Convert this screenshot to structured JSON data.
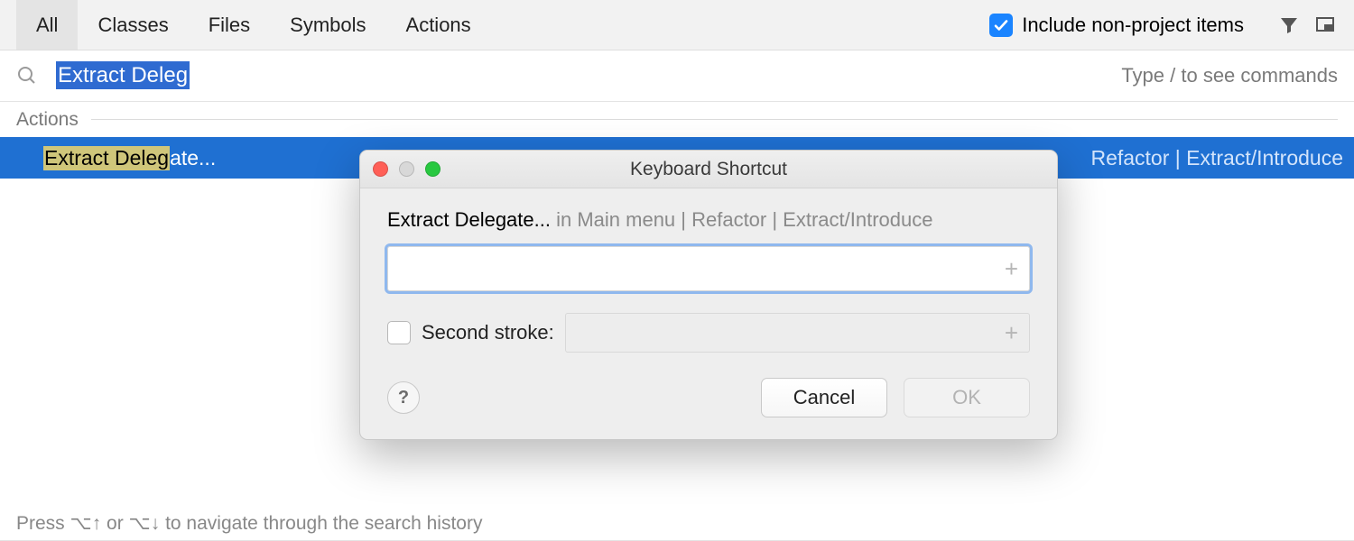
{
  "tabs": {
    "all": "All",
    "classes": "Classes",
    "files": "Files",
    "symbols": "Symbols",
    "actions": "Actions"
  },
  "include_label": "Include non-project items",
  "include_checked": true,
  "search": {
    "query": "Extract Deleg",
    "hint": "Type / to see commands"
  },
  "section": "Actions",
  "result": {
    "highlight": "Extract Deleg",
    "rest": "ate...",
    "path": "Refactor | Extract/Introduce"
  },
  "footer": "Press ⌥↑ or ⌥↓ to navigate through the search history",
  "dialog": {
    "title": "Keyboard Shortcut",
    "action_name": "Extract Delegate...",
    "action_context": " in Main menu | Refactor | Extract/Introduce",
    "second_stroke_label": "Second stroke:",
    "cancel": "Cancel",
    "ok": "OK",
    "help": "?"
  }
}
